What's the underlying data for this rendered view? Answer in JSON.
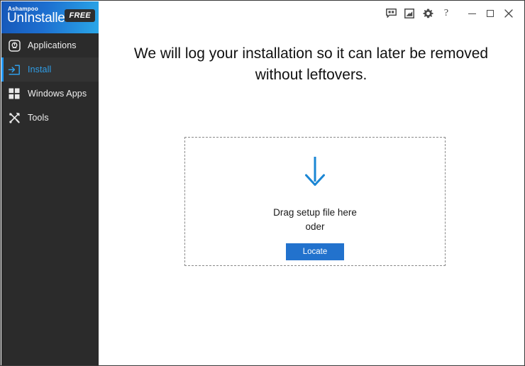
{
  "window": {
    "titlebar_buttons": [
      {
        "name": "feedback-icon",
        "label": "Feedback"
      },
      {
        "name": "news-icon",
        "label": "News"
      },
      {
        "name": "gear-icon",
        "label": "Settings"
      },
      {
        "name": "help-icon",
        "label": "?"
      },
      {
        "name": "minimize-icon",
        "label": "Minimize"
      },
      {
        "name": "maximize-icon",
        "label": "Maximize"
      },
      {
        "name": "close-icon",
        "label": "Close"
      }
    ],
    "help_glyph": "?",
    "close_glyph": "✕"
  },
  "brand": {
    "company": "Ashampoo",
    "product_prefix": "Un",
    "product_suffix": "Installer",
    "edition_badge": "FREE"
  },
  "sidebar": {
    "items": [
      {
        "label": "Applications",
        "icon": "applications-icon",
        "active": false
      },
      {
        "label": "Install",
        "icon": "install-icon",
        "active": true
      },
      {
        "label": "Windows Apps",
        "icon": "windows-apps-icon",
        "active": false
      },
      {
        "label": "Tools",
        "icon": "tools-icon",
        "active": false
      }
    ]
  },
  "main": {
    "headline": "We will log your installation so it can later be removed without leftovers.",
    "dropzone": {
      "arrow_icon": "download-arrow-icon",
      "primary_text": "Drag setup file here",
      "secondary_text": "oder",
      "button_label": "Locate"
    }
  },
  "colors": {
    "accent_blue": "#2196f3",
    "button_blue": "#2272cd",
    "arrow_blue": "#1a86d4",
    "sidebar_bg": "#2b2b2b",
    "sidebar_active_bg": "#333333",
    "brand_gradient_start": "#1557b8",
    "brand_gradient_end": "#2aa7e8"
  }
}
